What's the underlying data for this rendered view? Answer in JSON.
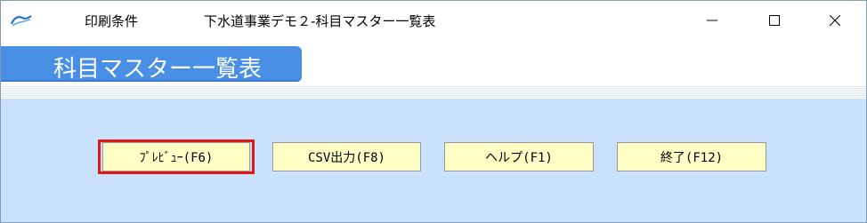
{
  "titlebar": {
    "left_label": "印刷条件",
    "center_label": "下水道事業デモ２-科目マスター一覧表",
    "app_icon": "acelink-logo-icon",
    "controls": [
      "minimize-icon",
      "maximize-icon",
      "close-icon"
    ]
  },
  "header": {
    "title": "科目マスター一覧表",
    "accent_color": "#4a8fe6"
  },
  "buttons": {
    "preview": "ﾌﾟﾚﾋﾞｭｰ(F6)",
    "csv": "CSV出力(F8)",
    "help": "ヘルプ(F1)",
    "exit": "終了(F12)"
  },
  "colors": {
    "background": "#c9e1fb",
    "button_fill": "#ffffc5",
    "focus_border": "#e01818"
  }
}
